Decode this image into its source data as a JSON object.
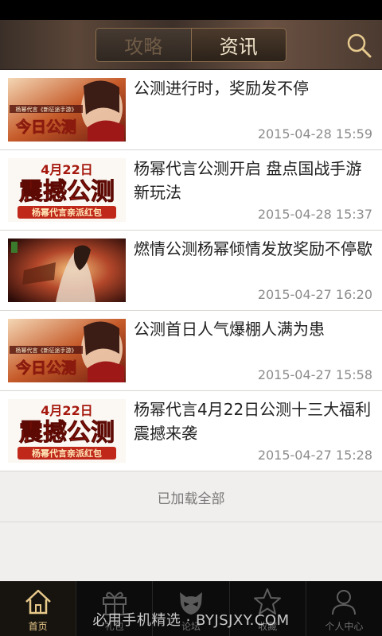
{
  "header": {
    "tabs": [
      {
        "label": "攻略",
        "active": false
      },
      {
        "label": "资讯",
        "active": true
      }
    ],
    "search_icon": "search-icon"
  },
  "news": [
    {
      "title": "公测进行时，奖励发不停",
      "time": "2015-04-28 15:59",
      "thumb": "yangmi-promo",
      "thumb_text": "今日公测",
      "thumb_sub": "杨幂代言《新征途手游》"
    },
    {
      "title": "杨幂代言公测开启 盘点国战手游新玩法",
      "time": "2015-04-28 15:37",
      "thumb": "launch-banner",
      "thumb_text": "震撼公测",
      "thumb_top": "4月22日",
      "thumb_sub": "杨幂代言亲派红包"
    },
    {
      "title": "燃情公测杨幂倾情发放奖励不停歇",
      "time": "2015-04-27 16:20",
      "thumb": "warrior-art"
    },
    {
      "title": "公测首日人气爆棚人满为患",
      "time": "2015-04-27 15:58",
      "thumb": "yangmi-promo",
      "thumb_text": "今日公测",
      "thumb_sub": "杨幂代言《新征途手游》"
    },
    {
      "title": "杨幂代言4月22日公测十三大福利震撼来袭",
      "time": "2015-04-27 15:28",
      "thumb": "launch-banner",
      "thumb_text": "震撼公测",
      "thumb_top": "4月22日",
      "thumb_sub": "杨幂代言亲派红包"
    }
  ],
  "footer_status": "已加载全部",
  "tabbar": [
    {
      "label": "首页",
      "icon": "home-icon",
      "active": true
    },
    {
      "label": "礼包",
      "icon": "gift-icon",
      "active": false
    },
    {
      "label": "论坛",
      "icon": "forum-mask-icon",
      "active": false
    },
    {
      "label": "收藏",
      "icon": "star-icon",
      "active": false
    },
    {
      "label": "个人中心",
      "icon": "user-icon",
      "active": false
    }
  ],
  "watermark": "必用手机精选 · BYJSJXY.COM",
  "colors": {
    "accent": "#e8c98a",
    "header_bg": "#4a3a30",
    "text": "#222222",
    "time": "#8c8c8c"
  }
}
